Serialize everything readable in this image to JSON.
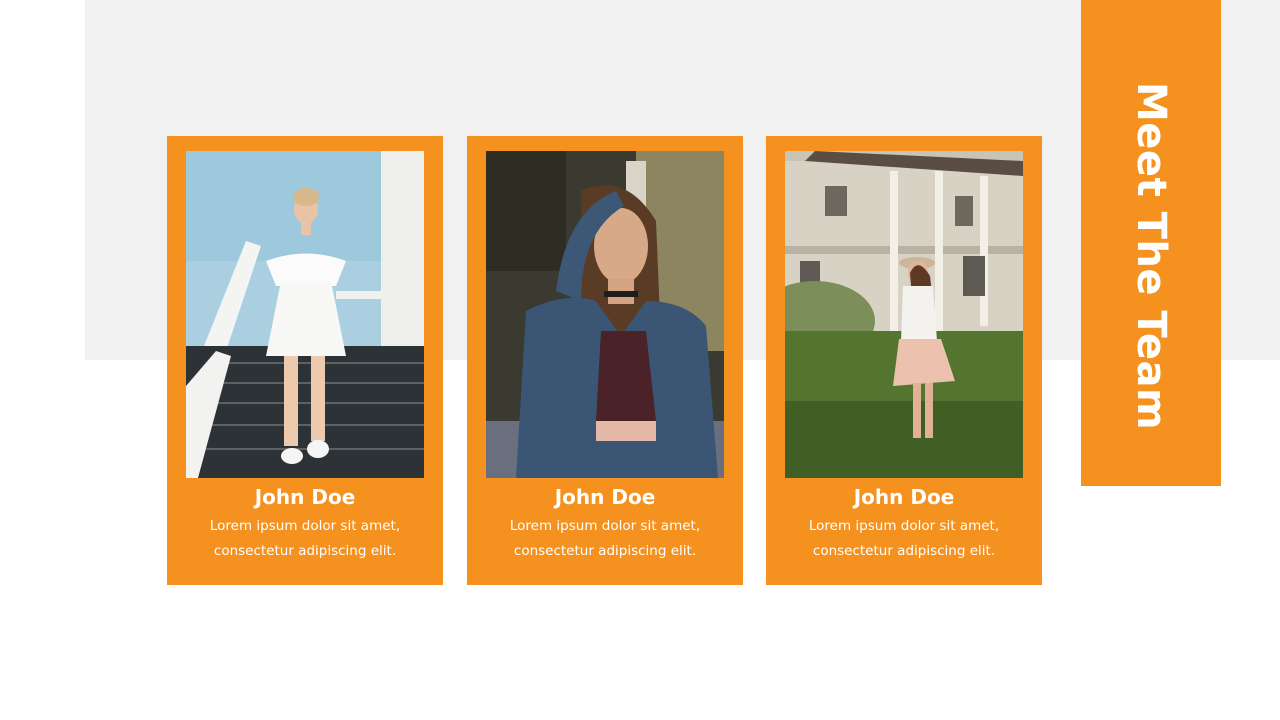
{
  "slide": {
    "title": "Meet The Team",
    "accent_color": "#f5911e",
    "band_color": "#f1f1f1"
  },
  "team": [
    {
      "name": "John Doe",
      "desc_line1": "Lorem ipsum dolor sit amet,",
      "desc_line2": "consectetur adipiscing elit."
    },
    {
      "name": "John Doe",
      "desc_line1": "Lorem ipsum dolor sit amet,",
      "desc_line2": "consectetur adipiscing elit."
    },
    {
      "name": "John Doe",
      "desc_line1": "Lorem ipsum dolor sit amet,",
      "desc_line2": "consectetur adipiscing elit."
    }
  ]
}
